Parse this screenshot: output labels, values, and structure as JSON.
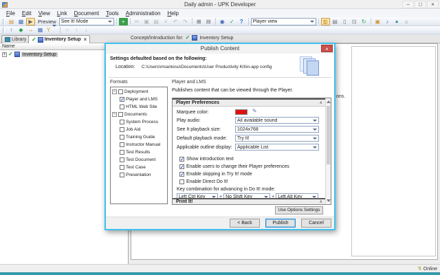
{
  "window": {
    "title": "Daily admin - UPK Developer",
    "controls": {
      "minimize": "−",
      "restore": "□",
      "close": "×"
    },
    "status_online": "Online"
  },
  "icons": {
    "close": "×",
    "minus": "−",
    "plus": "+",
    "collapse": "∧",
    "pencil": "✎",
    "online": "↯"
  },
  "colors": {
    "dialog_border": "#3EC1EE",
    "marquee_red": "#E01010",
    "check_blue": "#2E5FC8",
    "green_check": "#1E9E3E",
    "bottom_strip": "#3399AA"
  },
  "menu": {
    "items": [
      "File",
      "Edit",
      "View",
      "Link",
      "Document",
      "Tools",
      "Administration",
      "Help"
    ]
  },
  "toolbar": {
    "preview_label": "Preview",
    "mode_value": "See It! Mode",
    "view_value": "Player view",
    "row1_icons": [
      {
        "name": "open-icon",
        "glyph": "▤"
      },
      {
        "name": "save-icon",
        "glyph": "▦"
      },
      {
        "name": "preview-toggle-icon",
        "glyph": "▶"
      },
      {
        "name": "new-topic-icon",
        "glyph": "+"
      },
      {
        "name": "cut-icon",
        "glyph": "✂"
      },
      {
        "name": "copy-icon",
        "glyph": "▣"
      },
      {
        "name": "paste-icon",
        "glyph": "▤"
      },
      {
        "name": "delete-icon",
        "glyph": "×"
      },
      {
        "name": "undo-icon",
        "glyph": "↶"
      },
      {
        "name": "redo-icon",
        "glyph": "↷"
      },
      {
        "name": "expand-icon",
        "glyph": "⊞"
      },
      {
        "name": "collapse-icon",
        "glyph": "⊟"
      },
      {
        "name": "find-icon",
        "glyph": "◉"
      },
      {
        "name": "spellcheck-icon",
        "glyph": "✓"
      },
      {
        "name": "help-icon",
        "glyph": "?"
      },
      {
        "name": "outline-view-icon",
        "glyph": "▥"
      },
      {
        "name": "details-view-icon",
        "glyph": "▤"
      },
      {
        "name": "split-view-icon",
        "glyph": "▯"
      },
      {
        "name": "preview-pane-icon",
        "glyph": "⊡"
      },
      {
        "name": "refresh-icon",
        "glyph": "↻"
      },
      {
        "name": "new-window-icon",
        "glyph": "▣"
      },
      {
        "name": "sound-icon",
        "glyph": "♪"
      },
      {
        "name": "web-icon",
        "glyph": "●"
      },
      {
        "name": "home-icon",
        "glyph": "⌂"
      }
    ],
    "row2_icons": [
      {
        "name": "publish-icon",
        "glyph": "↑"
      },
      {
        "name": "package-icon",
        "glyph": "◆"
      },
      {
        "name": "export-icon",
        "glyph": "→"
      },
      {
        "name": "edit-grid-icon",
        "glyph": "▦"
      },
      {
        "name": "filter-icon",
        "glyph": "Y"
      },
      {
        "name": "link-icon",
        "glyph": "○"
      },
      {
        "name": "move-up-icon",
        "glyph": "↑"
      },
      {
        "name": "move-down-icon",
        "glyph": "↓"
      }
    ]
  },
  "tabs": {
    "library": "Library",
    "inventory": "Inventory Setup"
  },
  "outline": {
    "name_header": "Name",
    "tree_item": "Inventory Setup",
    "concept_prefix": "Concept/Introduction for:",
    "concept_item": "Inventory Setup",
    "text_fragment": "ons."
  },
  "dialog": {
    "title": "Publish Content",
    "settings_heading": "Settings defaulted based on the following:",
    "location_label": "Location:",
    "location_value": "C:\\Users\\msantosu\\Documents\\User Productivity Kit\\in-app config",
    "formats_label": "Formats",
    "selected_format": "Player and LMS",
    "format_description": "Publishes content that can be viewed through the Player.",
    "format_tree": [
      {
        "label": "Deployment",
        "level": 0,
        "checked": false
      },
      {
        "label": "Player and LMS",
        "level": 1,
        "checked": true
      },
      {
        "label": "HTML Web Site",
        "level": 1,
        "checked": false
      },
      {
        "label": "Documents",
        "level": 0,
        "checked": false
      },
      {
        "label": "System Process",
        "level": 1,
        "checked": false
      },
      {
        "label": "Job Aid",
        "level": 1,
        "checked": false
      },
      {
        "label": "Training Guide",
        "level": 1,
        "checked": false
      },
      {
        "label": "Instructor Manual",
        "level": 1,
        "checked": false
      },
      {
        "label": "Test Results",
        "level": 1,
        "checked": false
      },
      {
        "label": "Test Document",
        "level": 1,
        "checked": false
      },
      {
        "label": "Test Case",
        "level": 1,
        "checked": false
      },
      {
        "label": "Presentation",
        "level": 1,
        "checked": false
      }
    ],
    "sections": {
      "player_preferences": "Player Preferences",
      "print_it": "Print It!"
    },
    "fields": [
      {
        "label": "Marquee color:",
        "value": ""
      },
      {
        "label": "Play audio:",
        "value": "All available sound"
      },
      {
        "label": "See It playback size:",
        "value": "1024x768"
      },
      {
        "label": "Default playback mode:",
        "value": "Try It!"
      },
      {
        "label": "Applicable outline display:",
        "value": "Applicable List"
      }
    ],
    "checkboxes": [
      {
        "label": "Show introduction text",
        "checked": true
      },
      {
        "label": "Enable users to change their Player preferences",
        "checked": true
      },
      {
        "label": "Enable skipping in Try It! mode",
        "checked": true
      },
      {
        "label": "Enable Direct Do It!",
        "checked": false
      }
    ],
    "key_combo_label": "Key combination for advancing in Do It! mode:",
    "key_separator": "+",
    "key_combos": [
      "Left Ctrl Key",
      "No Shift Key",
      "Left Alt Key"
    ],
    "buttons": {
      "use_options": "Use Options Settings",
      "back": "< Back",
      "publish": "Publish",
      "cancel": "Cancel"
    }
  }
}
